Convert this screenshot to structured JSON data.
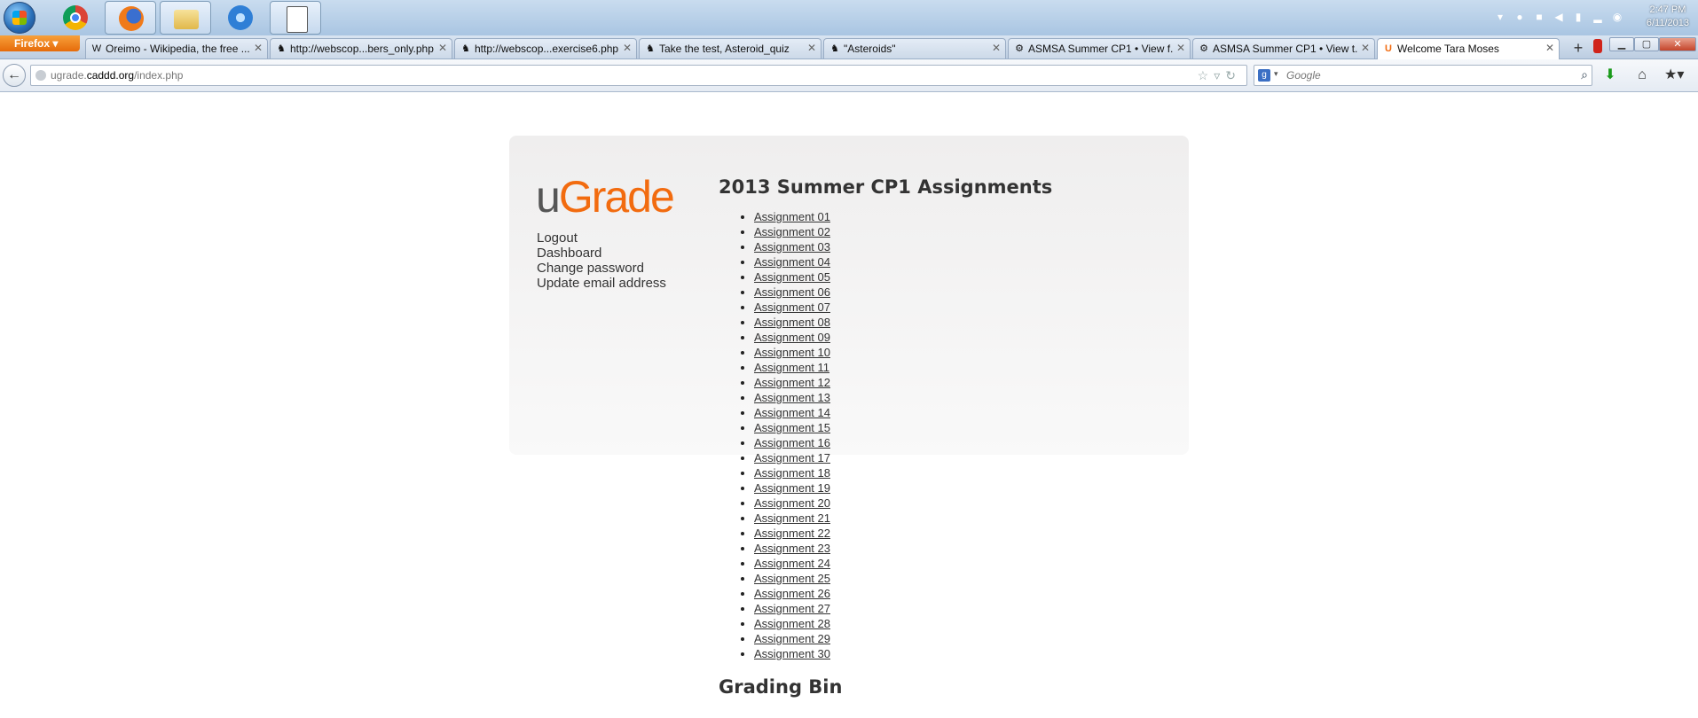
{
  "taskbar": {
    "apps": [
      {
        "name": "chrome"
      },
      {
        "name": "firefox",
        "active": true
      },
      {
        "name": "file-explorer"
      },
      {
        "name": "itunes"
      },
      {
        "name": "document"
      }
    ],
    "clock": {
      "time": "2:47 PM",
      "date": "6/11/2013"
    }
  },
  "browser": {
    "menu_label": "Firefox",
    "tabs": [
      {
        "favicon": "W",
        "title": "Oreimo - Wikipedia, the free ..."
      },
      {
        "favicon": "♞",
        "title": "http://webscop...bers_only.php"
      },
      {
        "favicon": "♞",
        "title": "http://webscop...exercise6.php"
      },
      {
        "favicon": "♞",
        "title": "Take the test, Asteroid_quiz"
      },
      {
        "favicon": "♞",
        "title": "\"Asteroids\""
      },
      {
        "favicon": "⚙",
        "title": "ASMSA Summer CP1 • View f..."
      },
      {
        "favicon": "⚙",
        "title": "ASMSA Summer CP1 • View t..."
      },
      {
        "favicon": "U",
        "title": "Welcome Tara Moses",
        "active": true
      }
    ],
    "url": {
      "prefix": "ugrade.",
      "domain": "caddd.org",
      "path": "/index.php"
    },
    "search_placeholder": "Google"
  },
  "page": {
    "logo": {
      "part1": "u",
      "part2": "Grade"
    },
    "menu": [
      "Logout",
      "Dashboard",
      "Change password",
      "Update email address"
    ],
    "heading": "2013 Summer CP1 Assignments",
    "assignments": [
      "Assignment 01",
      "Assignment 02",
      "Assignment 03",
      "Assignment 04",
      "Assignment 05",
      "Assignment 06",
      "Assignment 07",
      "Assignment 08",
      "Assignment 09",
      "Assignment 10",
      "Assignment 11",
      "Assignment 12",
      "Assignment 13",
      "Assignment 14",
      "Assignment 15",
      "Assignment 16",
      "Assignment 17",
      "Assignment 18",
      "Assignment 19",
      "Assignment 20",
      "Assignment 21",
      "Assignment 22",
      "Assignment 23",
      "Assignment 24",
      "Assignment 25",
      "Assignment 26",
      "Assignment 27",
      "Assignment 28",
      "Assignment 29",
      "Assignment 30"
    ],
    "grading_heading": "Grading Bin"
  }
}
